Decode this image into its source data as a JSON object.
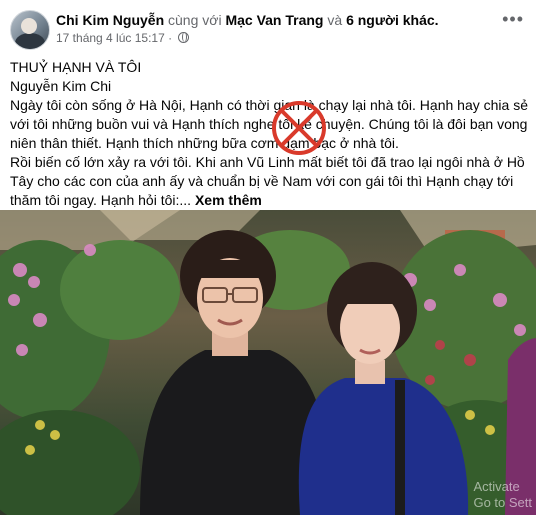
{
  "post": {
    "author": "Chi Kim Nguyễn",
    "with_word": "cùng với",
    "tagged": "Mạc Van Trang",
    "and_word": "và",
    "others": "6 người khác.",
    "timestamp": "17 tháng 4 lúc 15:17 ·",
    "title": "THUỶ HẠNH VÀ TÔI",
    "byline": "Nguyễn Kim Chi",
    "paragraph1": " Ngày tôi còn sống ở Hà Nội, Hạnh có thời gian là chạy lại nhà tôi. Hạnh hay chia sẻ với tôi những buồn vui và Hạnh thích nghe tôi kể chuyện. Chúng tôi là đôi bạn vong niên thân thiết. Hạnh thích những bữa cơm đạm bạc ở nhà tôi.",
    "paragraph2": "  Rồi biến cố lớn xảy ra với tôi. Khi anh Vũ Linh mất biết tôi đã trao lại ngôi nhà ở Hồ Tây cho các con của anh ấy và chuẩn bị về Nam với con gái tôi thì Hạnh chạy tới thăm tôi ngay. Hạnh hỏi tôi:...",
    "see_more": "Xem thêm"
  },
  "watermark": {
    "line1": "Activate",
    "line2": "Go to Sett"
  },
  "icons": {
    "privacy": "globe-icon",
    "more": "more-options-icon",
    "overlay": "red-cross-stamp"
  },
  "colors": {
    "text": "#050505",
    "secondary": "#65676b",
    "stamp": "#d93a2b"
  }
}
